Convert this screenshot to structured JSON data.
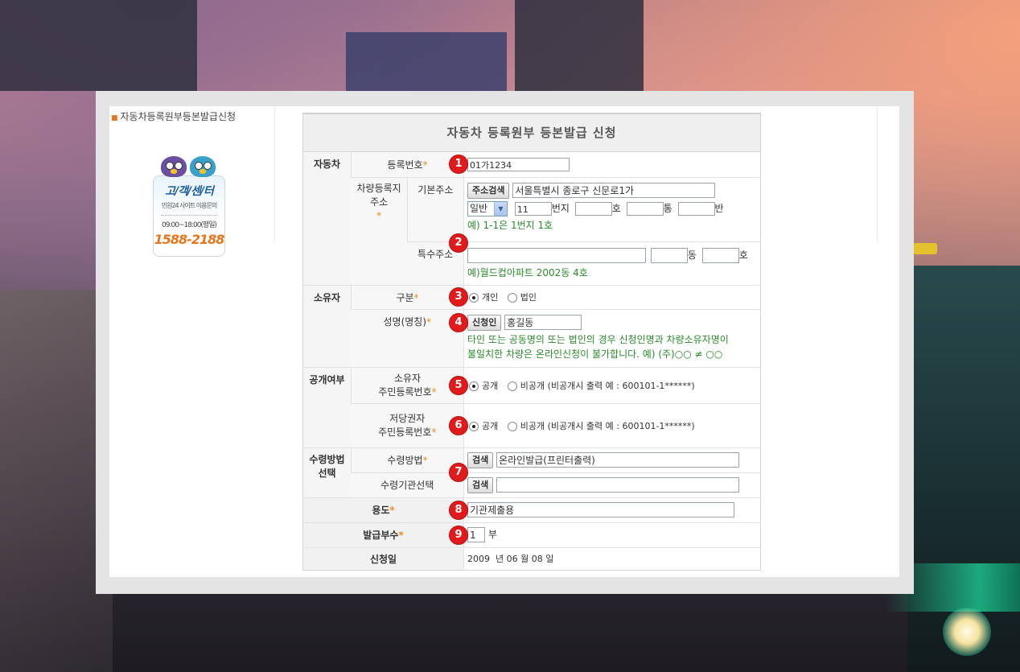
{
  "breadcrumb": "자동차등록원부등본발급신청",
  "call_center": {
    "title": "고/객/센/터",
    "subtitle": "민원24 사이트 이용문의",
    "hours": "09:00~18:00(평일)",
    "phone": "1588-2188"
  },
  "form": {
    "title": "자동차 등록원부 등본발급 신청",
    "sections": {
      "vehicle": "자동차",
      "owner": "소유자",
      "disclosure": "공개여부",
      "receipt": "수령방법 선택"
    },
    "badges": [
      "1",
      "2",
      "3",
      "4",
      "5",
      "6",
      "7",
      "8",
      "9"
    ],
    "reg_number": {
      "label": "등록번호",
      "required_mark": "*",
      "value": "01가1234"
    },
    "address": {
      "label": "차량등록지 주소",
      "required_mark": "*",
      "basic_label": "기본주소",
      "search_button": "주소검색",
      "basic_value": "서울특별시 종로구 신문로1가",
      "type_select": "일반",
      "bunji_value": "11",
      "unit_bunji": "번지",
      "unit_ho": "호",
      "unit_tong": "통",
      "unit_ban": "반",
      "basic_example": "예) 1-1은 1번지 1호",
      "special_label": "특수주소",
      "unit_dong": "동",
      "unit_ho2": "호",
      "special_example": "예)월드컵아파트 2002동 4호"
    },
    "owner_type": {
      "label": "구분",
      "required_mark": "*",
      "option1": "개인",
      "option2": "법인",
      "selected": "개인"
    },
    "owner_name": {
      "label": "성명(명칭)",
      "required_mark": "*",
      "button": "신청인",
      "value": "홍길동",
      "note_line1": "타인 또는 공동명의 또는 법인의 경우 신청인명과 차량소유자명이",
      "note_line2": "불일치한 차량은 온라인신청이 불가합니다. 예) (주)○○ ≠ ○○"
    },
    "owner_rrn": {
      "label_line1": "소유자",
      "label_line2": "주민등록번호",
      "required_mark": "*",
      "option1": "공개",
      "option2": "비공개",
      "hint": "(비공개시 출력 예 : 600101-1******)"
    },
    "mortgagee_rrn": {
      "label_line1": "저당권자",
      "label_line2": "주민등록번호",
      "required_mark": "*",
      "option1": "공개",
      "option2": "비공개",
      "hint": "(비공개시 출력 예 : 600101-1******)"
    },
    "receipt_method": {
      "label": "수령방법",
      "required_mark": "*",
      "button": "검색",
      "value": "온라인발급(프린터출력)"
    },
    "receipt_office": {
      "label": "수령기관선택",
      "button": "검색",
      "value": ""
    },
    "purpose": {
      "label": "용도",
      "required_mark": "*",
      "value": "기관제출용"
    },
    "copies": {
      "label": "발급부수",
      "required_mark": "*",
      "value": "1",
      "unit": "부"
    },
    "apply_date": {
      "label": "신청일",
      "year": "2009",
      "year_unit": "년",
      "month": "06",
      "month_unit": "월",
      "day": "08",
      "day_unit": "일"
    }
  }
}
